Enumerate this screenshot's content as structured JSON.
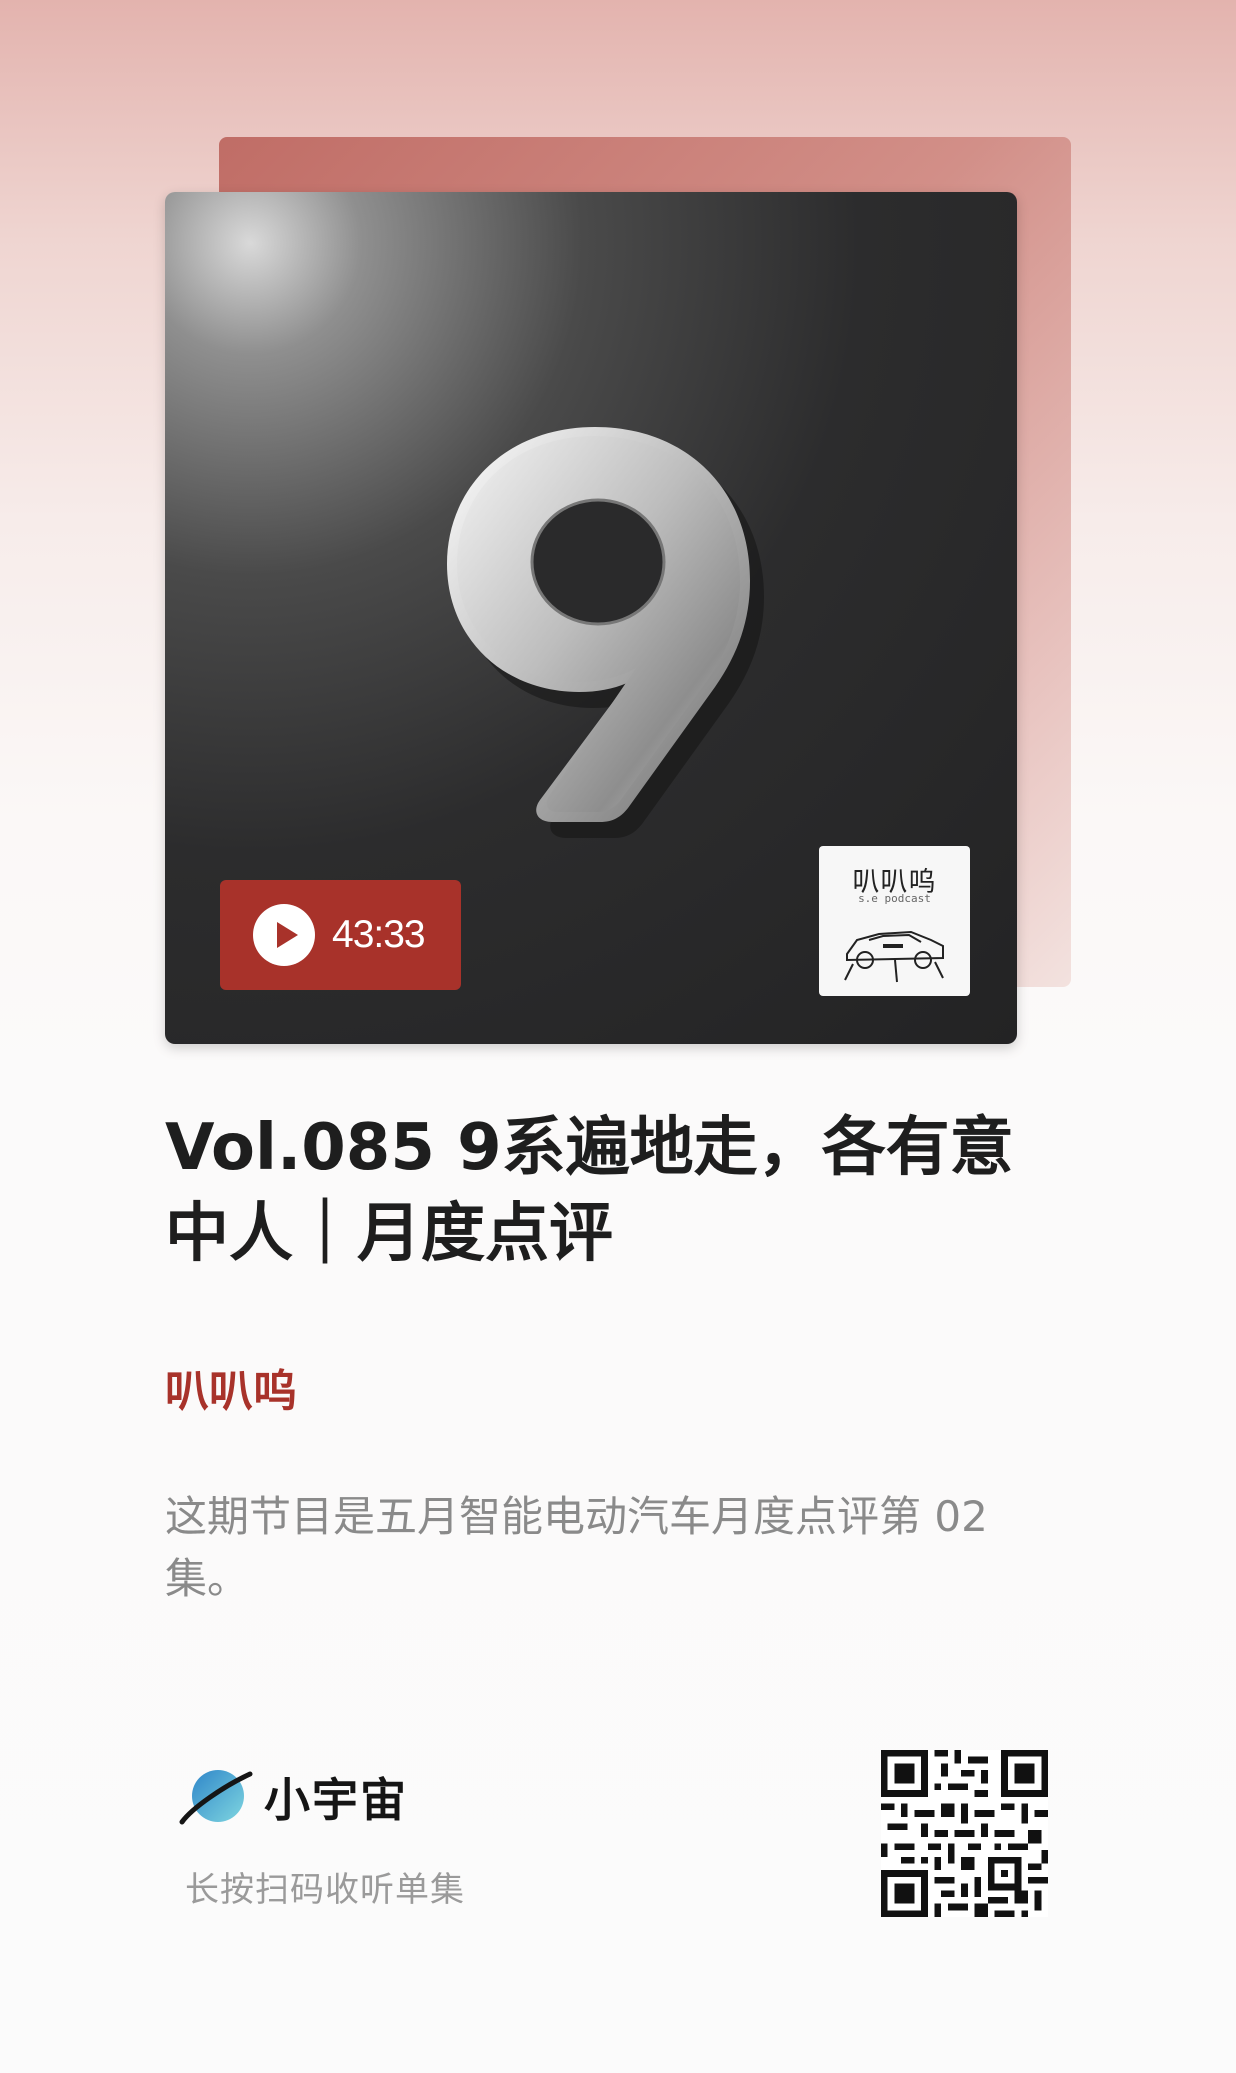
{
  "cover": {
    "duration": "43:33",
    "numeral": "9",
    "podcast_thumb": {
      "title": "叭叭呜",
      "subtitle": "s.e podcast"
    }
  },
  "episode": {
    "title": "Vol.085 9系遍地走，各有意中人｜月度点评"
  },
  "podcast": {
    "name": "叭叭呜"
  },
  "description": "这期节目是五月智能电动汽车月度点评第 02 集。",
  "footer": {
    "brand": "小宇宙",
    "scan_hint": "长按扫码收听单集"
  },
  "colors": {
    "accent": "#a8322a",
    "title": "#1e1e1e",
    "description": "#8a8a8a",
    "brand_blue": "#3ea6d8"
  },
  "icons": {
    "play": "play-icon",
    "brand_logo": "planet-logo-icon",
    "qr": "qr-code"
  }
}
